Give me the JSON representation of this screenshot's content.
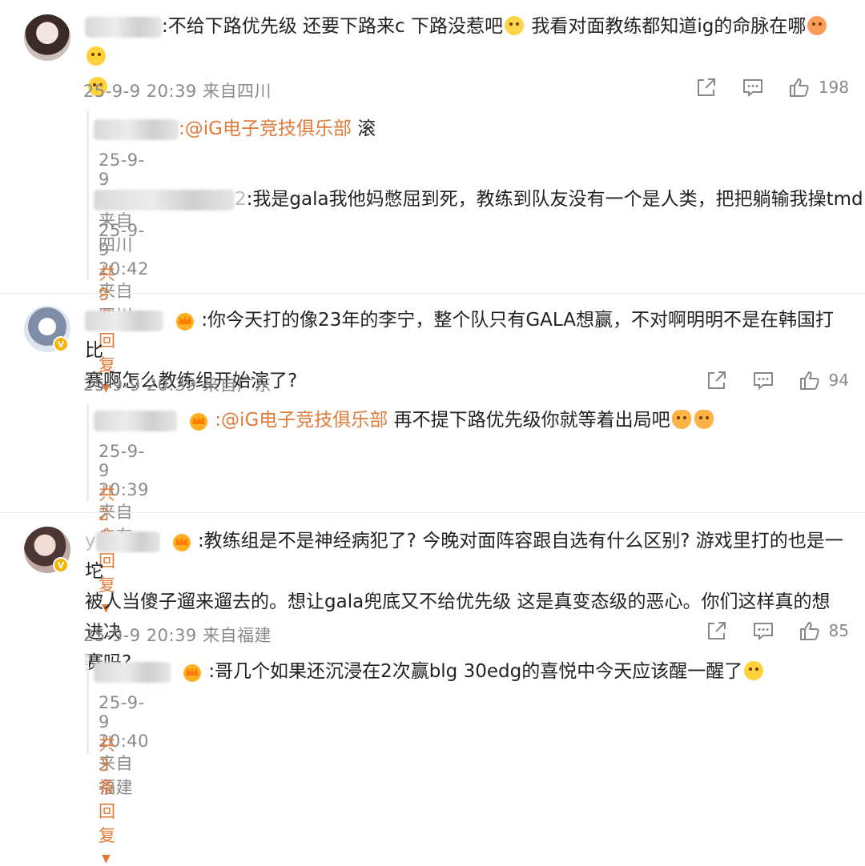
{
  "comments": [
    {
      "text_line1_suffix": ":不给下路优先级 还要下路来c 下路没惹吧",
      "text_line1_b": " 我看对面教练都知道ig的命脉在哪",
      "time": "25-9-9 20:39 来自四川",
      "likes": "198",
      "replies": [
        {
          "mention": ":@iG电子竞技俱乐部",
          "text": " 滚",
          "time": "25-9-9 20:39 来自四川"
        },
        {
          "prefix": "2",
          "text": ":我是gala我他妈憋屈到死，教练到队友没有一个是人类，把把躺输我操tmd",
          "time": "25-9-9 20:42 来自四川"
        }
      ],
      "more": "共9条回复"
    },
    {
      "text_line1": ":你今天打的像23年的李宁，整个队只有GALA想赢，不对啊明明不是在韩国打比",
      "text_line2": "赛啊怎么教练组开始演了?",
      "time": "25-9-9 20:39 来自广东",
      "likes": "94",
      "replies": [
        {
          "mention": ":@iG电子竞技俱乐部",
          "text": " 再不提下路优先级你就等着出局吧",
          "time": "25-9-9 20:39 来自广东"
        }
      ],
      "more": "共2条回复"
    },
    {
      "name_prefix": "y",
      "text_line1": ":教练组是不是神经病犯了? 今晚对面阵容跟自选有什么区别? 游戏里打的也是一坨",
      "text_line2": "被人当傻子遛来遛去的。想让gala兜底又不给优先级 这是真变态级的恶心。你们这样真的想进决",
      "text_line3": "赛吗?",
      "time": "25-9-9 20:39 来自福建",
      "likes": "85",
      "replies": [
        {
          "text": ":哥几个如果还沉浸在2次赢blg 30edg的喜悦中今天应该醒一醒了",
          "time": "25-9-9 20:40 来自福建"
        }
      ],
      "more": "共3条回复"
    }
  ],
  "icons": {
    "share": "share-icon",
    "comment": "comment-icon",
    "like": "thumbs-up-icon",
    "more": "caret-down-icon",
    "vip": "crown-badge-icon",
    "verified": "verified-badge-icon"
  },
  "colors": {
    "mention": "#e07b39",
    "meta": "#8a8a8a",
    "text": "#222222"
  }
}
